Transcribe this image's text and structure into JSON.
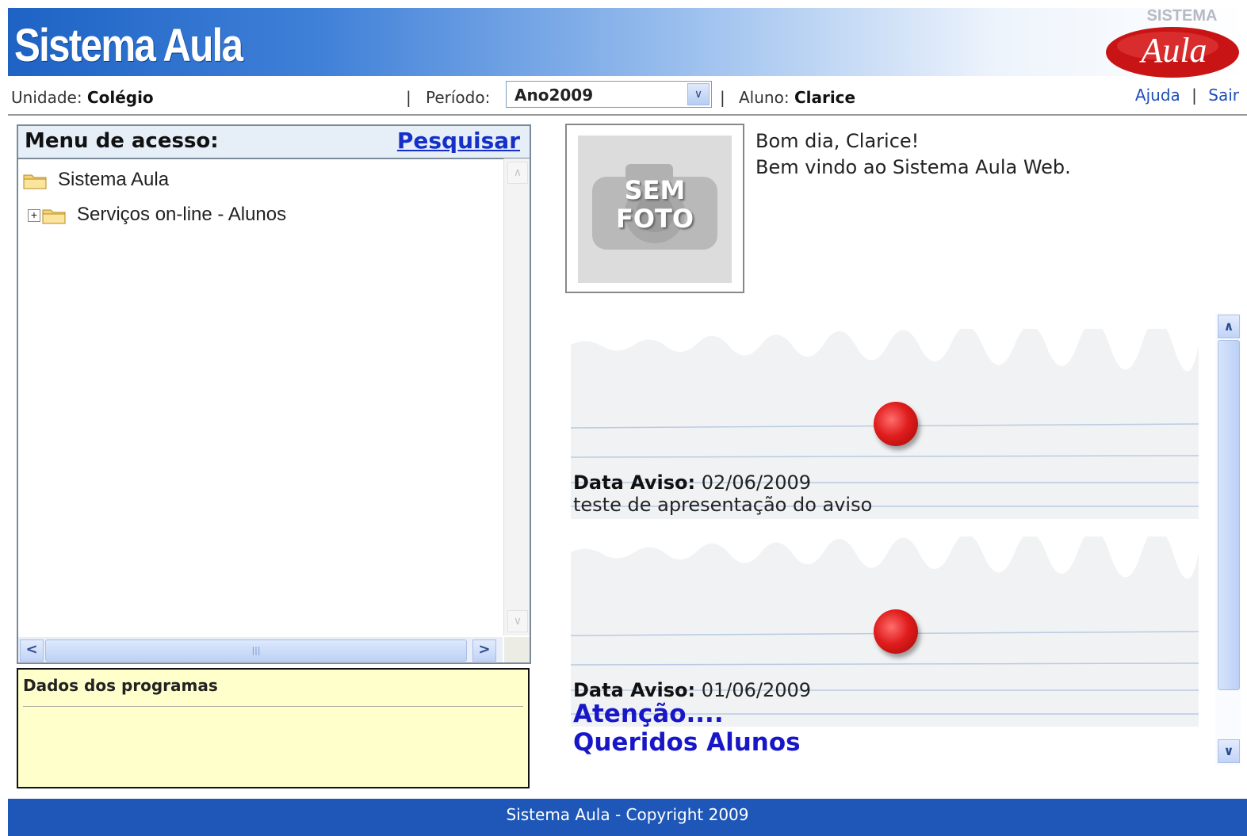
{
  "header": {
    "app_title": "Sistema Aula",
    "logo_top": "SISTEMA",
    "logo_text": "Aula"
  },
  "infobar": {
    "unidade_label": "Unidade:",
    "unidade_value": "Colégio",
    "periodo_label": "Período:",
    "periodo_value": "Ano2009",
    "aluno_label": "Aluno:",
    "aluno_value": "Clarice",
    "ajuda": "Ajuda",
    "sair": "Sair",
    "separator": "|"
  },
  "menu": {
    "title": "Menu de acesso:",
    "search_link": "Pesquisar",
    "tree": [
      {
        "label": "Sistema Aula",
        "expandable": false
      },
      {
        "label": "Serviços on-line - Alunos",
        "expandable": true
      }
    ]
  },
  "dados": {
    "title": "Dados dos programas"
  },
  "photo": {
    "line1": "SEM",
    "line2": "FOTO"
  },
  "greeting": {
    "line1": "Bom dia, Clarice!",
    "line2": "Bem vindo ao Sistema Aula Web."
  },
  "notices": [
    {
      "date_label": "Data Aviso:",
      "date": "02/06/2009",
      "text": "teste de apresentação do aviso"
    },
    {
      "date_label": "Data Aviso:",
      "date": "01/06/2009",
      "link1": "Atenção....",
      "link2": "Queridos Alunos"
    }
  ],
  "footer": {
    "text": "Sistema Aula - Copyright 2009"
  },
  "colors": {
    "header_blue": "#1e63c4",
    "footer_blue": "#1e57b8",
    "link_blue": "#1430c8",
    "notice_link": "#1717c8",
    "dados_bg": "#ffffcc",
    "pin_red": "#e01d1d"
  }
}
